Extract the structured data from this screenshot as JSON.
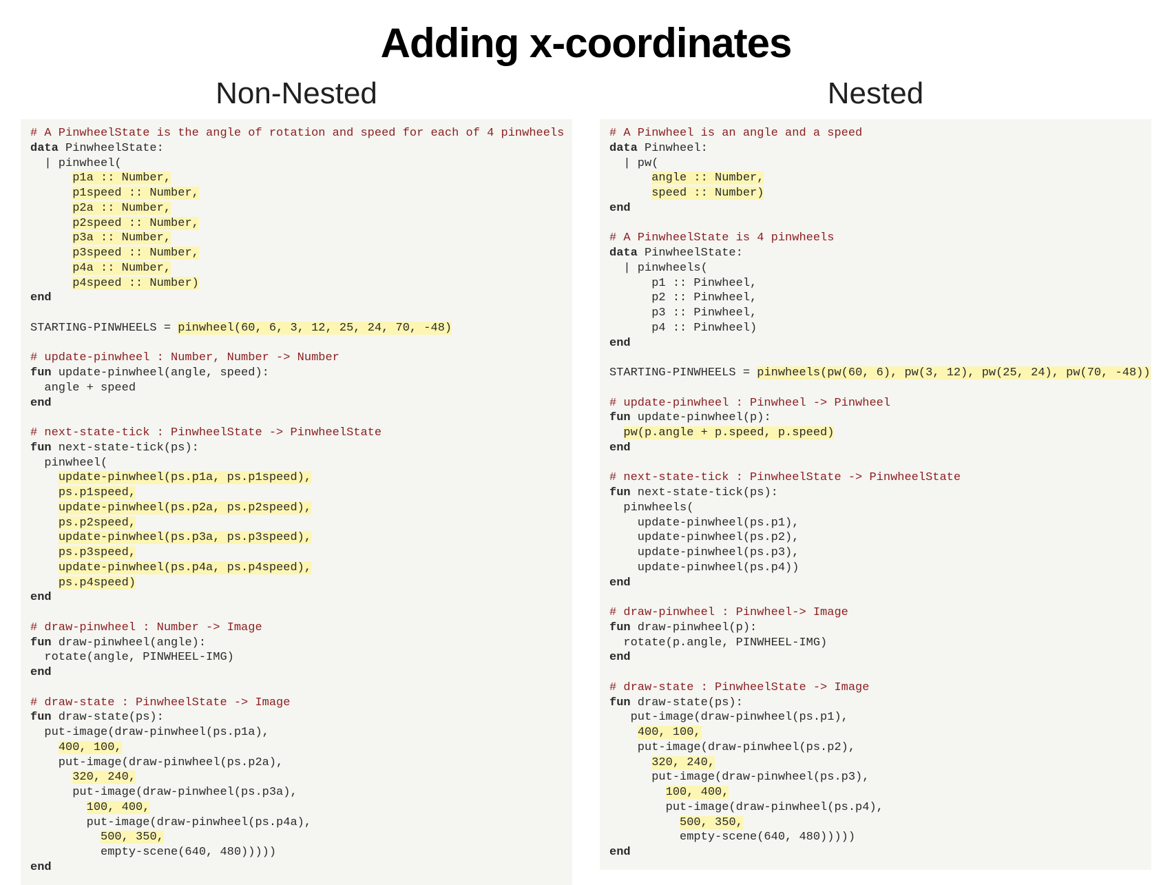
{
  "title": "Adding x-coordinates",
  "left": {
    "heading": "Non-Nested",
    "lines": [
      {
        "t": "comment",
        "text": "# A PinwheelState is the angle of rotation and speed for each of 4 pinwheels"
      },
      {
        "t": "plain",
        "parts": [
          {
            "kw": true,
            "txt": "data"
          },
          {
            "txt": " PinwheelState:"
          }
        ]
      },
      {
        "t": "plain",
        "parts": [
          {
            "txt": "  | pinwheel("
          }
        ]
      },
      {
        "t": "plain",
        "parts": [
          {
            "txt": "      "
          },
          {
            "hl": true,
            "txt": "p1a :: Number,"
          }
        ]
      },
      {
        "t": "plain",
        "parts": [
          {
            "txt": "      "
          },
          {
            "hl": true,
            "txt": "p1speed :: Number,"
          }
        ]
      },
      {
        "t": "plain",
        "parts": [
          {
            "txt": "      "
          },
          {
            "hl": true,
            "txt": "p2a :: Number,"
          }
        ]
      },
      {
        "t": "plain",
        "parts": [
          {
            "txt": "      "
          },
          {
            "hl": true,
            "txt": "p2speed :: Number,"
          }
        ]
      },
      {
        "t": "plain",
        "parts": [
          {
            "txt": "      "
          },
          {
            "hl": true,
            "txt": "p3a :: Number,"
          }
        ]
      },
      {
        "t": "plain",
        "parts": [
          {
            "txt": "      "
          },
          {
            "hl": true,
            "txt": "p3speed :: Number,"
          }
        ]
      },
      {
        "t": "plain",
        "parts": [
          {
            "txt": "      "
          },
          {
            "hl": true,
            "txt": "p4a :: Number,"
          }
        ]
      },
      {
        "t": "plain",
        "parts": [
          {
            "txt": "      "
          },
          {
            "hl": true,
            "txt": "p4speed :: Number)"
          }
        ]
      },
      {
        "t": "plain",
        "parts": [
          {
            "kw": true,
            "txt": "end"
          }
        ]
      },
      {
        "t": "blank"
      },
      {
        "t": "plain",
        "parts": [
          {
            "txt": "STARTING-PINWHEELS = "
          },
          {
            "hl": true,
            "txt": "pinwheel(60, 6, 3, 12, 25, 24, 70, -48)"
          }
        ]
      },
      {
        "t": "blank"
      },
      {
        "t": "comment",
        "text": "# update-pinwheel : Number, Number -> Number"
      },
      {
        "t": "plain",
        "parts": [
          {
            "kw": true,
            "txt": "fun"
          },
          {
            "txt": " update-pinwheel(angle, speed):"
          }
        ]
      },
      {
        "t": "plain",
        "parts": [
          {
            "txt": "  angle + speed"
          }
        ]
      },
      {
        "t": "plain",
        "parts": [
          {
            "kw": true,
            "txt": "end"
          }
        ]
      },
      {
        "t": "blank"
      },
      {
        "t": "comment",
        "text": "# next-state-tick : PinwheelState -> PinwheelState"
      },
      {
        "t": "plain",
        "parts": [
          {
            "kw": true,
            "txt": "fun"
          },
          {
            "txt": " next-state-tick(ps):"
          }
        ]
      },
      {
        "t": "plain",
        "parts": [
          {
            "txt": "  pinwheel("
          }
        ]
      },
      {
        "t": "plain",
        "parts": [
          {
            "txt": "    "
          },
          {
            "hl": true,
            "txt": "update-pinwheel(ps.p1a, ps.p1speed),"
          }
        ]
      },
      {
        "t": "plain",
        "parts": [
          {
            "txt": "    "
          },
          {
            "hl": true,
            "txt": "ps.p1speed,"
          }
        ]
      },
      {
        "t": "plain",
        "parts": [
          {
            "txt": "    "
          },
          {
            "hl": true,
            "txt": "update-pinwheel(ps.p2a, ps.p2speed),"
          }
        ]
      },
      {
        "t": "plain",
        "parts": [
          {
            "txt": "    "
          },
          {
            "hl": true,
            "txt": "ps.p2speed,"
          }
        ]
      },
      {
        "t": "plain",
        "parts": [
          {
            "txt": "    "
          },
          {
            "hl": true,
            "txt": "update-pinwheel(ps.p3a, ps.p3speed),"
          }
        ]
      },
      {
        "t": "plain",
        "parts": [
          {
            "txt": "    "
          },
          {
            "hl": true,
            "txt": "ps.p3speed,"
          }
        ]
      },
      {
        "t": "plain",
        "parts": [
          {
            "txt": "    "
          },
          {
            "hl": true,
            "txt": "update-pinwheel(ps.p4a, ps.p4speed),"
          }
        ]
      },
      {
        "t": "plain",
        "parts": [
          {
            "txt": "    "
          },
          {
            "hl": true,
            "txt": "ps.p4speed)"
          }
        ]
      },
      {
        "t": "plain",
        "parts": [
          {
            "kw": true,
            "txt": "end"
          }
        ]
      },
      {
        "t": "blank"
      },
      {
        "t": "comment",
        "text": "# draw-pinwheel : Number -> Image"
      },
      {
        "t": "plain",
        "parts": [
          {
            "kw": true,
            "txt": "fun"
          },
          {
            "txt": " draw-pinwheel(angle):"
          }
        ]
      },
      {
        "t": "plain",
        "parts": [
          {
            "txt": "  rotate(angle, PINWHEEL-IMG)"
          }
        ]
      },
      {
        "t": "plain",
        "parts": [
          {
            "kw": true,
            "txt": "end"
          }
        ]
      },
      {
        "t": "blank"
      },
      {
        "t": "comment",
        "text": "# draw-state : PinwheelState -> Image"
      },
      {
        "t": "plain",
        "parts": [
          {
            "kw": true,
            "txt": "fun"
          },
          {
            "txt": " draw-state(ps):"
          }
        ]
      },
      {
        "t": "plain",
        "parts": [
          {
            "txt": "  put-image(draw-pinwheel(ps.p1a),"
          }
        ]
      },
      {
        "t": "plain",
        "parts": [
          {
            "txt": "    "
          },
          {
            "hl": true,
            "txt": "400, 100,"
          }
        ]
      },
      {
        "t": "plain",
        "parts": [
          {
            "txt": "    put-image(draw-pinwheel(ps.p2a),"
          }
        ]
      },
      {
        "t": "plain",
        "parts": [
          {
            "txt": "      "
          },
          {
            "hl": true,
            "txt": "320, 240,"
          }
        ]
      },
      {
        "t": "plain",
        "parts": [
          {
            "txt": "      put-image(draw-pinwheel(ps.p3a),"
          }
        ]
      },
      {
        "t": "plain",
        "parts": [
          {
            "txt": "        "
          },
          {
            "hl": true,
            "txt": "100, 400,"
          }
        ]
      },
      {
        "t": "plain",
        "parts": [
          {
            "txt": "        put-image(draw-pinwheel(ps.p4a),"
          }
        ]
      },
      {
        "t": "plain",
        "parts": [
          {
            "txt": "          "
          },
          {
            "hl": true,
            "txt": "500, 350,"
          }
        ]
      },
      {
        "t": "plain",
        "parts": [
          {
            "txt": "          empty-scene(640, 480)))))"
          }
        ]
      },
      {
        "t": "plain",
        "parts": [
          {
            "kw": true,
            "txt": "end"
          }
        ]
      }
    ]
  },
  "right": {
    "heading": "Nested",
    "lines": [
      {
        "t": "comment",
        "text": "# A Pinwheel is an angle and a speed"
      },
      {
        "t": "plain",
        "parts": [
          {
            "kw": true,
            "txt": "data"
          },
          {
            "txt": " Pinwheel:"
          }
        ]
      },
      {
        "t": "plain",
        "parts": [
          {
            "txt": "  | pw("
          }
        ]
      },
      {
        "t": "plain",
        "parts": [
          {
            "txt": "      "
          },
          {
            "hl": true,
            "txt": "angle :: Number,"
          }
        ]
      },
      {
        "t": "plain",
        "parts": [
          {
            "txt": "      "
          },
          {
            "hl": true,
            "txt": "speed :: Number)"
          }
        ]
      },
      {
        "t": "plain",
        "parts": [
          {
            "kw": true,
            "txt": "end"
          }
        ]
      },
      {
        "t": "blank"
      },
      {
        "t": "comment",
        "text": "# A PinwheelState is 4 pinwheels"
      },
      {
        "t": "plain",
        "parts": [
          {
            "kw": true,
            "txt": "data"
          },
          {
            "txt": " PinwheelState:"
          }
        ]
      },
      {
        "t": "plain",
        "parts": [
          {
            "txt": "  | pinwheels("
          }
        ]
      },
      {
        "t": "plain",
        "parts": [
          {
            "txt": "      p1 :: Pinwheel,"
          }
        ]
      },
      {
        "t": "plain",
        "parts": [
          {
            "txt": "      p2 :: Pinwheel,"
          }
        ]
      },
      {
        "t": "plain",
        "parts": [
          {
            "txt": "      p3 :: Pinwheel,"
          }
        ]
      },
      {
        "t": "plain",
        "parts": [
          {
            "txt": "      p4 :: Pinwheel)"
          }
        ]
      },
      {
        "t": "plain",
        "parts": [
          {
            "kw": true,
            "txt": "end"
          }
        ]
      },
      {
        "t": "blank"
      },
      {
        "t": "plain",
        "parts": [
          {
            "txt": "STARTING-PINWHEELS = "
          },
          {
            "hl": true,
            "txt": "pinwheels(pw(60, 6), pw(3, 12), pw(25, 24), pw(70, -48))"
          }
        ]
      },
      {
        "t": "blank"
      },
      {
        "t": "comment",
        "text": "# update-pinwheel : Pinwheel -> Pinwheel"
      },
      {
        "t": "plain",
        "parts": [
          {
            "kw": true,
            "txt": "fun"
          },
          {
            "txt": " update-pinwheel(p):"
          }
        ]
      },
      {
        "t": "plain",
        "parts": [
          {
            "txt": "  "
          },
          {
            "hl": true,
            "txt": "pw(p.angle + p.speed, p.speed)"
          }
        ]
      },
      {
        "t": "plain",
        "parts": [
          {
            "kw": true,
            "txt": "end"
          }
        ]
      },
      {
        "t": "blank"
      },
      {
        "t": "comment",
        "text": "# next-state-tick : PinwheelState -> PinwheelState"
      },
      {
        "t": "plain",
        "parts": [
          {
            "kw": true,
            "txt": "fun"
          },
          {
            "txt": " next-state-tick(ps):"
          }
        ]
      },
      {
        "t": "plain",
        "parts": [
          {
            "txt": "  pinwheels("
          }
        ]
      },
      {
        "t": "plain",
        "parts": [
          {
            "txt": "    update-pinwheel(ps.p1),"
          }
        ]
      },
      {
        "t": "plain",
        "parts": [
          {
            "txt": "    update-pinwheel(ps.p2),"
          }
        ]
      },
      {
        "t": "plain",
        "parts": [
          {
            "txt": "    update-pinwheel(ps.p3),"
          }
        ]
      },
      {
        "t": "plain",
        "parts": [
          {
            "txt": "    update-pinwheel(ps.p4))"
          }
        ]
      },
      {
        "t": "plain",
        "parts": [
          {
            "kw": true,
            "txt": "end"
          }
        ]
      },
      {
        "t": "blank"
      },
      {
        "t": "comment",
        "text": "# draw-pinwheel : Pinwheel-> Image"
      },
      {
        "t": "plain",
        "parts": [
          {
            "kw": true,
            "txt": "fun"
          },
          {
            "txt": " draw-pinwheel(p):"
          }
        ]
      },
      {
        "t": "plain",
        "parts": [
          {
            "txt": "  rotate(p.angle, PINWHEEL-IMG)"
          }
        ]
      },
      {
        "t": "plain",
        "parts": [
          {
            "kw": true,
            "txt": "end"
          }
        ]
      },
      {
        "t": "blank"
      },
      {
        "t": "comment",
        "text": "# draw-state : PinwheelState -> Image"
      },
      {
        "t": "plain",
        "parts": [
          {
            "kw": true,
            "txt": "fun"
          },
          {
            "txt": " draw-state(ps):"
          }
        ]
      },
      {
        "t": "plain",
        "parts": [
          {
            "txt": "   put-image(draw-pinwheel(ps.p1),"
          }
        ]
      },
      {
        "t": "plain",
        "parts": [
          {
            "txt": "    "
          },
          {
            "hl": true,
            "txt": "400, 100,"
          }
        ]
      },
      {
        "t": "plain",
        "parts": [
          {
            "txt": "    put-image(draw-pinwheel(ps.p2),"
          }
        ]
      },
      {
        "t": "plain",
        "parts": [
          {
            "txt": "      "
          },
          {
            "hl": true,
            "txt": "320, 240,"
          }
        ]
      },
      {
        "t": "plain",
        "parts": [
          {
            "txt": "      put-image(draw-pinwheel(ps.p3),"
          }
        ]
      },
      {
        "t": "plain",
        "parts": [
          {
            "txt": "        "
          },
          {
            "hl": true,
            "txt": "100, 400,"
          }
        ]
      },
      {
        "t": "plain",
        "parts": [
          {
            "txt": "        put-image(draw-pinwheel(ps.p4),"
          }
        ]
      },
      {
        "t": "plain",
        "parts": [
          {
            "txt": "          "
          },
          {
            "hl": true,
            "txt": "500, 350,"
          }
        ]
      },
      {
        "t": "plain",
        "parts": [
          {
            "txt": "          empty-scene(640, 480)))))"
          }
        ]
      },
      {
        "t": "plain",
        "parts": [
          {
            "kw": true,
            "txt": "end"
          }
        ]
      }
    ]
  }
}
